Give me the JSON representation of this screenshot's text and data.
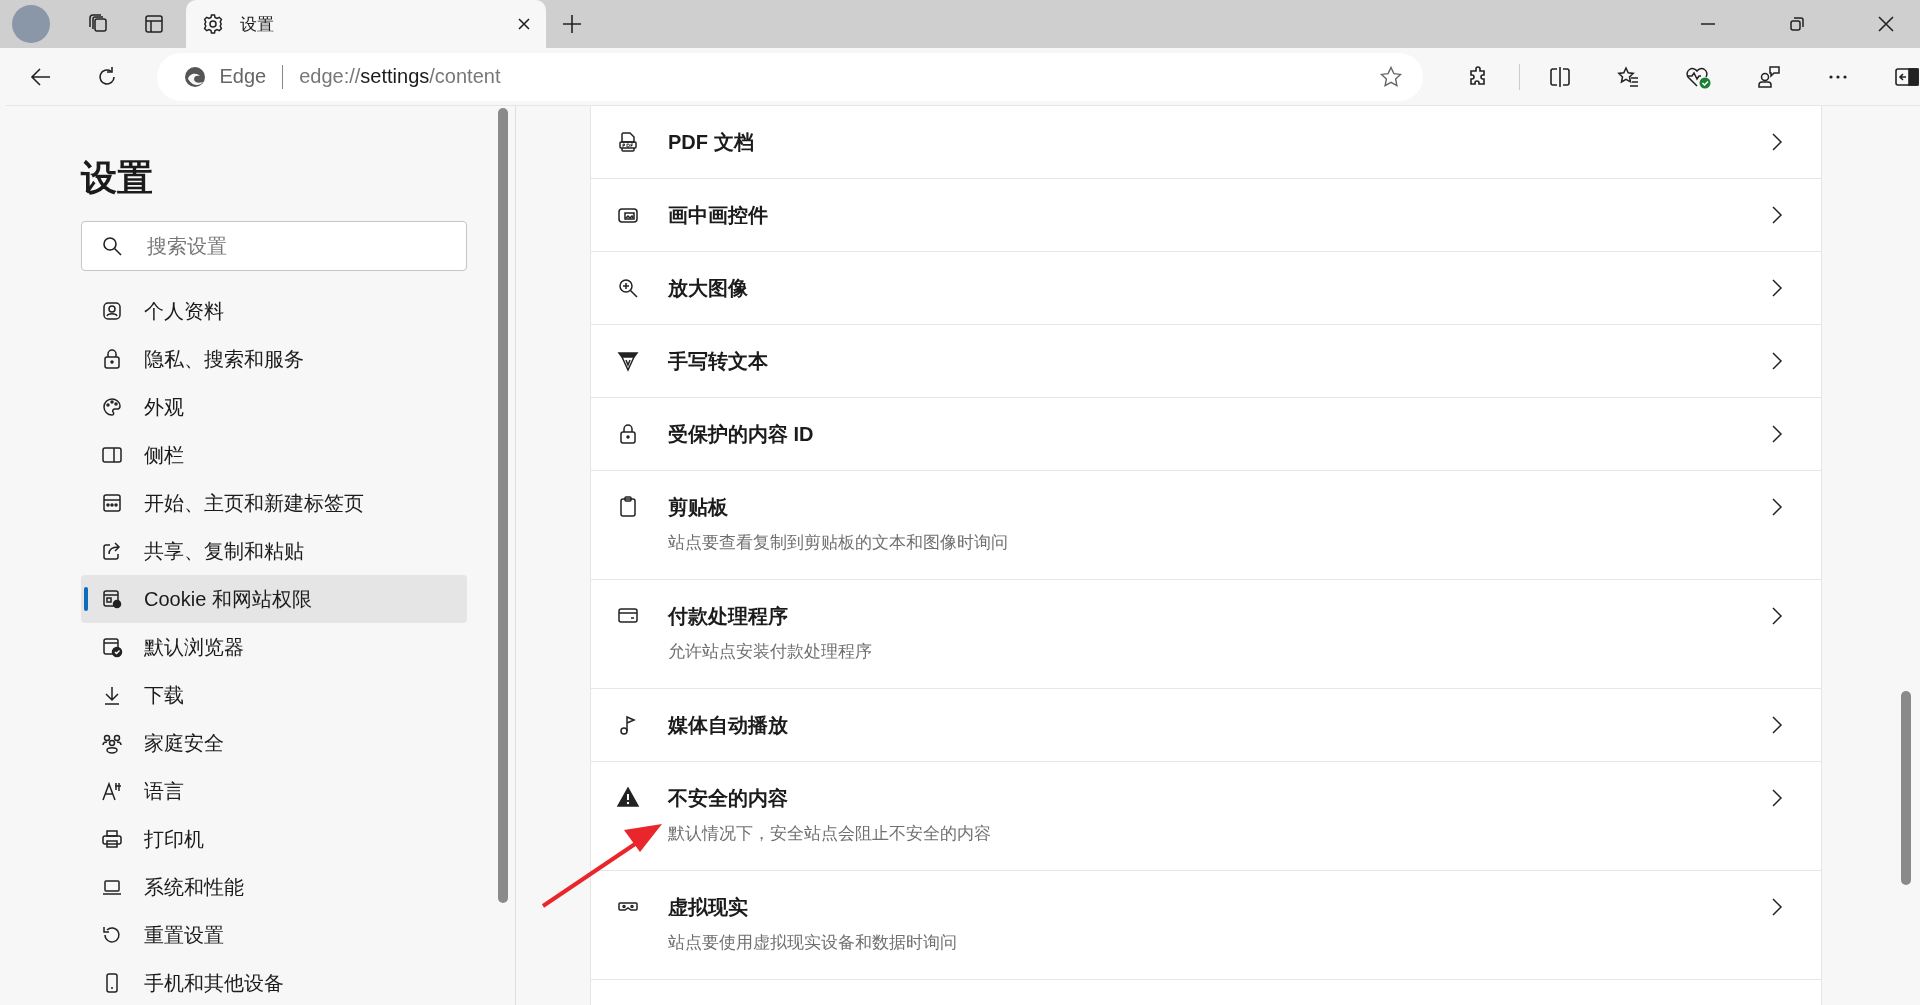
{
  "tabs": [
    {
      "title": "设置",
      "selected": true
    }
  ],
  "address_bar": {
    "site_label": "Edge",
    "url": "edge://**settings**/content"
  },
  "sidebar": {
    "title": "设置",
    "search": {
      "placeholder": "搜索设置"
    },
    "items": [
      {
        "label": "个人资料",
        "selected": false
      },
      {
        "label": "隐私、搜索和服务",
        "selected": false
      },
      {
        "label": "外观",
        "selected": false
      },
      {
        "label": "侧栏",
        "selected": false
      },
      {
        "label": "开始、主页和新建标签页",
        "selected": false
      },
      {
        "label": "共享、复制和粘贴",
        "selected": false
      },
      {
        "label": "Cookie 和网站权限",
        "selected": true
      },
      {
        "label": "默认浏览器",
        "selected": false
      },
      {
        "label": "下载",
        "selected": false
      },
      {
        "label": "家庭安全",
        "selected": false
      },
      {
        "label": "语言",
        "selected": false
      },
      {
        "label": "打印机",
        "selected": false
      },
      {
        "label": "系统和性能",
        "selected": false
      },
      {
        "label": "重置设置",
        "selected": false
      },
      {
        "label": "手机和其他设备",
        "selected": false
      }
    ]
  },
  "content": {
    "rows": [
      {
        "title": "PDF 文档"
      },
      {
        "title": "画中画控件"
      },
      {
        "title": "放大图像"
      },
      {
        "title": "手写转文本"
      },
      {
        "title": "受保护的内容 ID"
      },
      {
        "title": "剪贴板",
        "description": "站点要查看复制到剪贴板的文本和图像时询问"
      },
      {
        "title": "付款处理程序",
        "description": "允许站点安装付款处理程序"
      },
      {
        "title": "媒体自动播放"
      },
      {
        "title": "不安全的内容",
        "description": "默认情况下，安全站点会阻止不安全的内容"
      },
      {
        "title": "虚拟现实",
        "description": "站点要使用虚拟现实设备和数据时询问"
      }
    ]
  }
}
